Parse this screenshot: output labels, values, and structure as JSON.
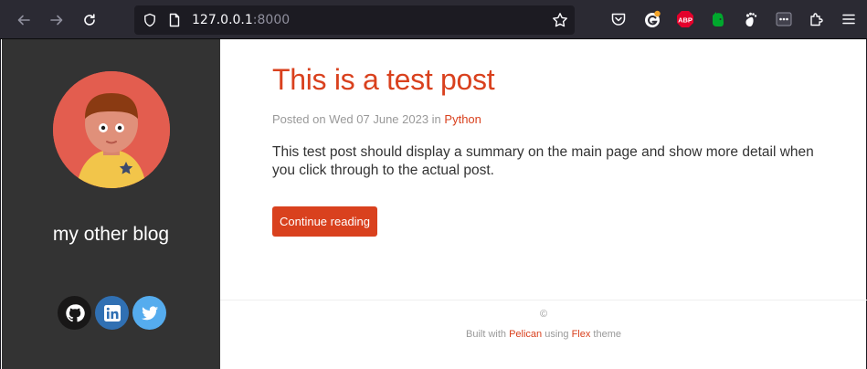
{
  "browser": {
    "url_host": "127.0.0.1",
    "url_port": ":8000",
    "extensions": [
      {
        "name": "grammarly",
        "color": "#ffffff"
      },
      {
        "name": "adblock-plus",
        "label": "ABP",
        "color": "#e4002b"
      },
      {
        "name": "evernote",
        "color": "#00a82d"
      },
      {
        "name": "gnome",
        "color": "#ffffff"
      }
    ]
  },
  "sidebar": {
    "site_name": "my other blog",
    "social": [
      {
        "name": "github",
        "color": "#181717"
      },
      {
        "name": "linkedin",
        "color": "#3070b3"
      },
      {
        "name": "twitter",
        "color": "#55acee"
      }
    ]
  },
  "post": {
    "title": "This is a test post",
    "meta_prefix": "Posted on Wed 07 June 2023 in ",
    "category": "Python",
    "summary": "This test post should display a summary on the main page and show more detail when you click through to the actual post.",
    "continue_label": "Continue reading"
  },
  "footer": {
    "copyright": "©",
    "built_with": "Built with ",
    "pelican": "Pelican",
    "using": " using ",
    "flex": "Flex",
    "theme": " theme"
  },
  "colors": {
    "accent": "#d9411e",
    "sidebar_bg": "#333333",
    "avatar_bg": "#e35d4f"
  }
}
